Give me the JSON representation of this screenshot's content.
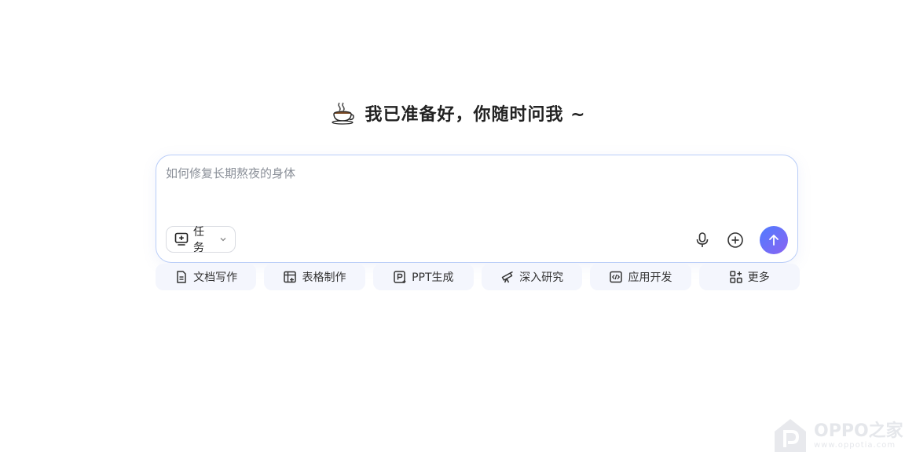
{
  "headline": {
    "emoji_icon": "hot-beverage-icon",
    "title": "我已准备好，你随时问我 ~"
  },
  "composer": {
    "placeholder": "如何修复长期熬夜的身体",
    "task_button": {
      "label": "任务",
      "icon": "monitor-plus-icon"
    },
    "tools": [
      {
        "name": "microphone-icon"
      },
      {
        "name": "add-circle-icon"
      }
    ],
    "send_icon": "arrow-up-icon",
    "colors": {
      "border": "#b9cdf8",
      "send_from": "#4f7cff",
      "send_to": "#8a63f2"
    }
  },
  "quick_actions": [
    {
      "label": "文档写作",
      "icon": "document-icon"
    },
    {
      "label": "表格制作",
      "icon": "table-icon"
    },
    {
      "label": "PPT生成",
      "icon": "presentation-icon"
    },
    {
      "label": "深入研究",
      "icon": "telescope-icon"
    },
    {
      "label": "应用开发",
      "icon": "code-window-icon"
    },
    {
      "label": "更多",
      "icon": "grid-plus-icon"
    }
  ],
  "watermark": {
    "name": "OPPO之家",
    "url": "www.oppotia.com"
  }
}
